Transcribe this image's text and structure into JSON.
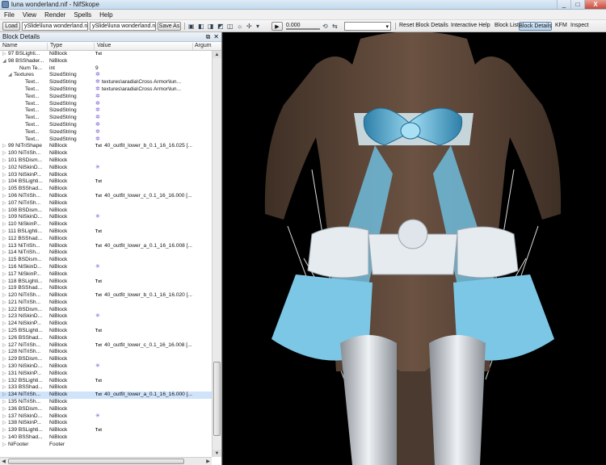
{
  "window": {
    "title": "luna wonderland.nif - NifSkope",
    "controls": [
      "_",
      "□",
      "X"
    ]
  },
  "menu": [
    "File",
    "View",
    "Render",
    "Spells",
    "Help"
  ],
  "toolbar": {
    "load_label": "Load",
    "load_path": "ySlide\\luna wonderland.nif",
    "save_path": "ySlide\\luna wonderland.nif",
    "save_as_label": "Save As",
    "time_value": "0.000",
    "buttons": [
      "Reset Block Details",
      "Interactive Help",
      "Block List",
      "Block Details",
      "KFM",
      "Inspect"
    ],
    "active_button": "Block Details"
  },
  "panel": {
    "title": "Block Details",
    "columns": [
      "Name",
      "Type",
      "Value",
      "Argum"
    ],
    "rows": [
      {
        "name": "97 BSLighti...",
        "type": "NiBlock",
        "value": "",
        "txt": true,
        "icon": "",
        "exp": "+",
        "sel": false,
        "indent": 0
      },
      {
        "name": "98 BSShader...",
        "type": "NiBlock",
        "value": "",
        "txt": false,
        "icon": "",
        "exp": "-",
        "sel": false,
        "indent": 0
      },
      {
        "name": "Num Te...",
        "type": "int",
        "value": "9",
        "txt": false,
        "icon": "",
        "exp": "",
        "sel": false,
        "indent": 2
      },
      {
        "name": "Textures",
        "type": "SizedString",
        "value": "",
        "txt": false,
        "icon": "✲",
        "exp": "-",
        "sel": false,
        "indent": 1
      },
      {
        "name": "Text...",
        "type": "SizedString",
        "value": "textures\\aradia\\Cross Armor\\lun...",
        "txt": false,
        "icon": "✲",
        "exp": "",
        "sel": false,
        "indent": 3
      },
      {
        "name": "Text...",
        "type": "SizedString",
        "value": "textures\\aradia\\Cross Armor\\lun...",
        "txt": false,
        "icon": "✲",
        "exp": "",
        "sel": false,
        "indent": 3
      },
      {
        "name": "Text...",
        "type": "SizedString",
        "value": "",
        "txt": false,
        "icon": "✲",
        "exp": "",
        "sel": false,
        "indent": 3
      },
      {
        "name": "Text...",
        "type": "SizedString",
        "value": "",
        "txt": false,
        "icon": "✲",
        "exp": "",
        "sel": false,
        "indent": 3
      },
      {
        "name": "Text...",
        "type": "SizedString",
        "value": "",
        "txt": false,
        "icon": "✲",
        "exp": "",
        "sel": false,
        "indent": 3
      },
      {
        "name": "Text...",
        "type": "SizedString",
        "value": "",
        "txt": false,
        "icon": "✲",
        "exp": "",
        "sel": false,
        "indent": 3
      },
      {
        "name": "Text...",
        "type": "SizedString",
        "value": "",
        "txt": false,
        "icon": "✲",
        "exp": "",
        "sel": false,
        "indent": 3
      },
      {
        "name": "Text...",
        "type": "SizedString",
        "value": "",
        "txt": false,
        "icon": "✲",
        "exp": "",
        "sel": false,
        "indent": 3
      },
      {
        "name": "Text...",
        "type": "SizedString",
        "value": "",
        "txt": false,
        "icon": "✲",
        "exp": "",
        "sel": false,
        "indent": 3
      },
      {
        "name": "99 NiTriShape",
        "type": "NiBlock",
        "value": "40_outfit_lower_b_0.1_16_16.025 [...",
        "txt": true,
        "icon": "",
        "exp": "+",
        "sel": false,
        "indent": 0
      },
      {
        "name": "100 NiTriSh...",
        "type": "NiBlock",
        "value": "",
        "txt": false,
        "icon": "",
        "exp": "+",
        "sel": false,
        "indent": 0
      },
      {
        "name": "101 BSDism...",
        "type": "NiBlock",
        "value": "",
        "txt": false,
        "icon": "",
        "exp": "+",
        "sel": false,
        "indent": 0
      },
      {
        "name": "102 NiSkinD...",
        "type": "NiBlock",
        "value": "",
        "txt": false,
        "icon": "✳",
        "exp": "+",
        "sel": false,
        "indent": 0
      },
      {
        "name": "103 NiSkinP...",
        "type": "NiBlock",
        "value": "",
        "txt": false,
        "icon": "",
        "exp": "+",
        "sel": false,
        "indent": 0
      },
      {
        "name": "104 BSLighti...",
        "type": "NiBlock",
        "value": "",
        "txt": true,
        "icon": "",
        "exp": "+",
        "sel": false,
        "indent": 0
      },
      {
        "name": "105 BSShad...",
        "type": "NiBlock",
        "value": "",
        "txt": false,
        "icon": "",
        "exp": "+",
        "sel": false,
        "indent": 0
      },
      {
        "name": "106 NiTriSh...",
        "type": "NiBlock",
        "value": "40_outfit_lower_c_0.1_16_16.000 [...",
        "txt": true,
        "icon": "",
        "exp": "+",
        "sel": false,
        "indent": 0
      },
      {
        "name": "107 NiTriSh...",
        "type": "NiBlock",
        "value": "",
        "txt": false,
        "icon": "",
        "exp": "+",
        "sel": false,
        "indent": 0
      },
      {
        "name": "108 BSDism...",
        "type": "NiBlock",
        "value": "",
        "txt": false,
        "icon": "",
        "exp": "+",
        "sel": false,
        "indent": 0
      },
      {
        "name": "109 NiSkinD...",
        "type": "NiBlock",
        "value": "",
        "txt": false,
        "icon": "✳",
        "exp": "+",
        "sel": false,
        "indent": 0
      },
      {
        "name": "110 NiSkinP...",
        "type": "NiBlock",
        "value": "",
        "txt": false,
        "icon": "",
        "exp": "+",
        "sel": false,
        "indent": 0
      },
      {
        "name": "111 BSLighti...",
        "type": "NiBlock",
        "value": "",
        "txt": true,
        "icon": "",
        "exp": "+",
        "sel": false,
        "indent": 0
      },
      {
        "name": "112 BSShad...",
        "type": "NiBlock",
        "value": "",
        "txt": false,
        "icon": "",
        "exp": "+",
        "sel": false,
        "indent": 0
      },
      {
        "name": "113 NiTriSh...",
        "type": "NiBlock",
        "value": "40_outfit_lower_a_0.1_16_16.008 [...",
        "txt": true,
        "icon": "",
        "exp": "+",
        "sel": false,
        "indent": 0
      },
      {
        "name": "114 NiTriSh...",
        "type": "NiBlock",
        "value": "",
        "txt": false,
        "icon": "",
        "exp": "+",
        "sel": false,
        "indent": 0
      },
      {
        "name": "115 BSDism...",
        "type": "NiBlock",
        "value": "",
        "txt": false,
        "icon": "",
        "exp": "+",
        "sel": false,
        "indent": 0
      },
      {
        "name": "116 NiSkinD...",
        "type": "NiBlock",
        "value": "",
        "txt": false,
        "icon": "✳",
        "exp": "+",
        "sel": false,
        "indent": 0
      },
      {
        "name": "117 NiSkinP...",
        "type": "NiBlock",
        "value": "",
        "txt": false,
        "icon": "",
        "exp": "+",
        "sel": false,
        "indent": 0
      },
      {
        "name": "118 BSLighti...",
        "type": "NiBlock",
        "value": "",
        "txt": true,
        "icon": "",
        "exp": "+",
        "sel": false,
        "indent": 0
      },
      {
        "name": "119 BSShad...",
        "type": "NiBlock",
        "value": "",
        "txt": false,
        "icon": "",
        "exp": "+",
        "sel": false,
        "indent": 0
      },
      {
        "name": "120 NiTriSh...",
        "type": "NiBlock",
        "value": "40_outfit_lower_b_0.1_16_16.020 [...",
        "txt": true,
        "icon": "",
        "exp": "+",
        "sel": false,
        "indent": 0
      },
      {
        "name": "121 NiTriSh...",
        "type": "NiBlock",
        "value": "",
        "txt": false,
        "icon": "",
        "exp": "+",
        "sel": false,
        "indent": 0
      },
      {
        "name": "122 BSDism...",
        "type": "NiBlock",
        "value": "",
        "txt": false,
        "icon": "",
        "exp": "+",
        "sel": false,
        "indent": 0
      },
      {
        "name": "123 NiSkinD...",
        "type": "NiBlock",
        "value": "",
        "txt": false,
        "icon": "✳",
        "exp": "+",
        "sel": false,
        "indent": 0
      },
      {
        "name": "124 NiSkinP...",
        "type": "NiBlock",
        "value": "",
        "txt": false,
        "icon": "",
        "exp": "+",
        "sel": false,
        "indent": 0
      },
      {
        "name": "125 BSLighti...",
        "type": "NiBlock",
        "value": "",
        "txt": true,
        "icon": "",
        "exp": "+",
        "sel": false,
        "indent": 0
      },
      {
        "name": "126 BSShad...",
        "type": "NiBlock",
        "value": "",
        "txt": false,
        "icon": "",
        "exp": "+",
        "sel": false,
        "indent": 0
      },
      {
        "name": "127 NiTriSh...",
        "type": "NiBlock",
        "value": "40_outfit_lower_c_0.1_16_16.008 [...",
        "txt": true,
        "icon": "",
        "exp": "+",
        "sel": false,
        "indent": 0
      },
      {
        "name": "128 NiTriSh...",
        "type": "NiBlock",
        "value": "",
        "txt": false,
        "icon": "",
        "exp": "+",
        "sel": false,
        "indent": 0
      },
      {
        "name": "129 BSDism...",
        "type": "NiBlock",
        "value": "",
        "txt": false,
        "icon": "",
        "exp": "+",
        "sel": false,
        "indent": 0
      },
      {
        "name": "130 NiSkinD...",
        "type": "NiBlock",
        "value": "",
        "txt": false,
        "icon": "✳",
        "exp": "+",
        "sel": false,
        "indent": 0
      },
      {
        "name": "131 NiSkinP...",
        "type": "NiBlock",
        "value": "",
        "txt": false,
        "icon": "",
        "exp": "+",
        "sel": false,
        "indent": 0
      },
      {
        "name": "132 BSLighti...",
        "type": "NiBlock",
        "value": "",
        "txt": true,
        "icon": "",
        "exp": "+",
        "sel": false,
        "indent": 0
      },
      {
        "name": "133 BSShad...",
        "type": "NiBlock",
        "value": "",
        "txt": false,
        "icon": "",
        "exp": "+",
        "sel": false,
        "indent": 0
      },
      {
        "name": "134 NiTriSh...",
        "type": "NiBlock",
        "value": "40_outfit_lower_a_0.1_16_16.000 [...",
        "txt": true,
        "icon": "",
        "exp": "+",
        "sel": true,
        "indent": 0
      },
      {
        "name": "135 NiTriSh...",
        "type": "NiBlock",
        "value": "",
        "txt": false,
        "icon": "",
        "exp": "+",
        "sel": false,
        "indent": 0
      },
      {
        "name": "136 BSDism...",
        "type": "NiBlock",
        "value": "",
        "txt": false,
        "icon": "",
        "exp": "+",
        "sel": false,
        "indent": 0
      },
      {
        "name": "137 NiSkinD...",
        "type": "NiBlock",
        "value": "",
        "txt": false,
        "icon": "✳",
        "exp": "+",
        "sel": false,
        "indent": 0
      },
      {
        "name": "138 NiSkinP...",
        "type": "NiBlock",
        "value": "",
        "txt": false,
        "icon": "",
        "exp": "+",
        "sel": false,
        "indent": 0
      },
      {
        "name": "139 BSLighti...",
        "type": "NiBlock",
        "value": "",
        "txt": true,
        "icon": "",
        "exp": "+",
        "sel": false,
        "indent": 0
      },
      {
        "name": "140 BSShad...",
        "type": "NiBlock",
        "value": "",
        "txt": false,
        "icon": "",
        "exp": "+",
        "sel": false,
        "indent": 0
      },
      {
        "name": "NiFooter",
        "type": "Footer",
        "value": "",
        "txt": false,
        "icon": "",
        "exp": "+",
        "sel": false,
        "indent": 0
      }
    ]
  },
  "txt_tag": "Txt",
  "colors": {
    "skin": "#5a4536",
    "ribbon": "#7cc7e6",
    "ribbon_dark": "#2d7fa8",
    "white": "#e8eef3",
    "bg": "#000000",
    "selection": "#cfe3fb"
  }
}
